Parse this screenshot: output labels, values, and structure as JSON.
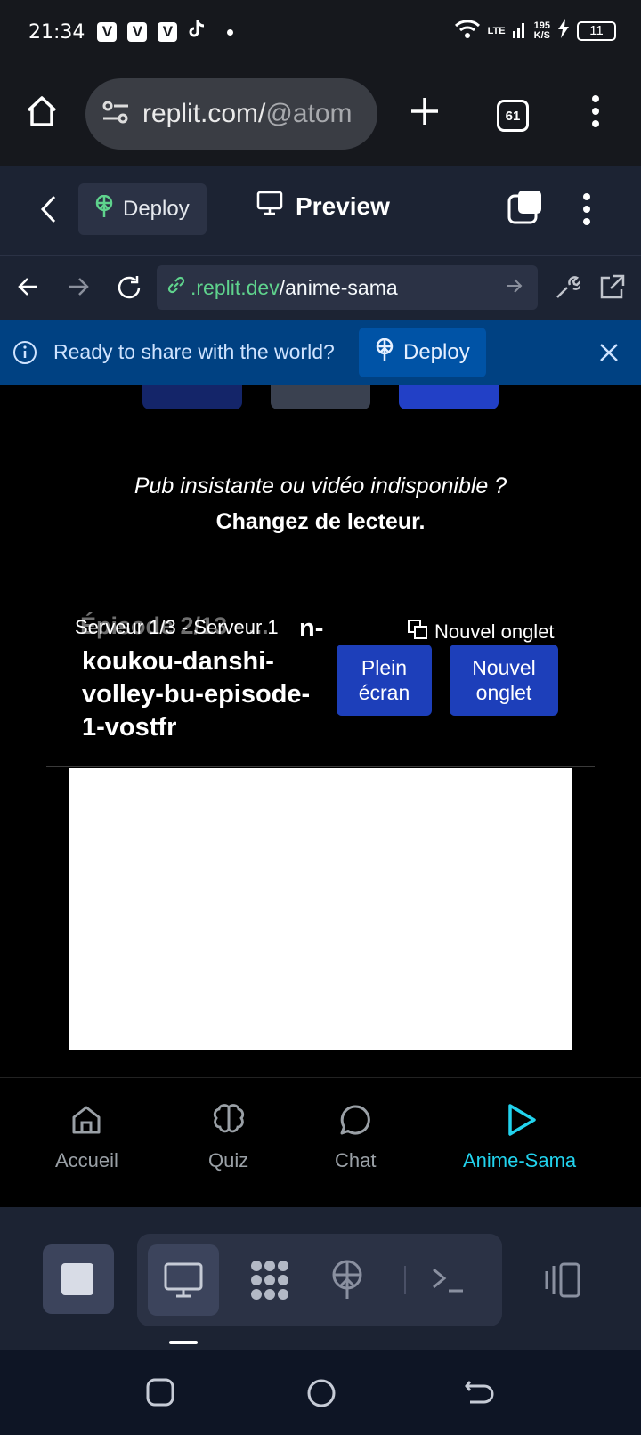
{
  "status_bar": {
    "time": "21:34",
    "notifications": [
      "V",
      "V",
      "V"
    ],
    "network": "LTE",
    "speed_value": "195",
    "speed_unit": "K/S",
    "battery": "11"
  },
  "browser": {
    "url_domain": "replit.com/",
    "url_path": "@atom",
    "tab_count": "61"
  },
  "replit_header": {
    "deploy_label": "Deploy",
    "preview_label": "Preview"
  },
  "replit_urlbar": {
    "domain": ".replit.dev",
    "path": "/anime-sama"
  },
  "deploy_banner": {
    "text": "Ready to share with the world?",
    "button_label": "Deploy"
  },
  "page": {
    "notice_line1": "Pub insistante ou vidéo indisponible ?",
    "notice_line2": "Changez de lecteur.",
    "episode_ghost": "Épisode 2/13 - ...",
    "server_label": "Serveur 1/3 - Serveur 1",
    "episode_title": "koukou-danshi-volley-bu-episode-1-vostfr",
    "episode_title_first": "n-",
    "new_tab_small": "Nouvel onglet",
    "fullscreen_line1": "Plein",
    "fullscreen_line2": "écran",
    "new_tab_line1": "Nouvel",
    "new_tab_line2": "onglet"
  },
  "app_nav": [
    {
      "label": "Accueil",
      "icon": "home-icon",
      "active": false
    },
    {
      "label": "Quiz",
      "icon": "brain-icon",
      "active": false
    },
    {
      "label": "Chat",
      "icon": "chat-icon",
      "active": false
    },
    {
      "label": "Anime-Sama",
      "icon": "play-icon",
      "active": true
    }
  ],
  "colors": {
    "replit_bg": "#1c2333",
    "banner_bg": "#004182",
    "button_blue": "#1d3fba",
    "active_nav": "#22d3ee",
    "url_green": "#5fd38d"
  }
}
